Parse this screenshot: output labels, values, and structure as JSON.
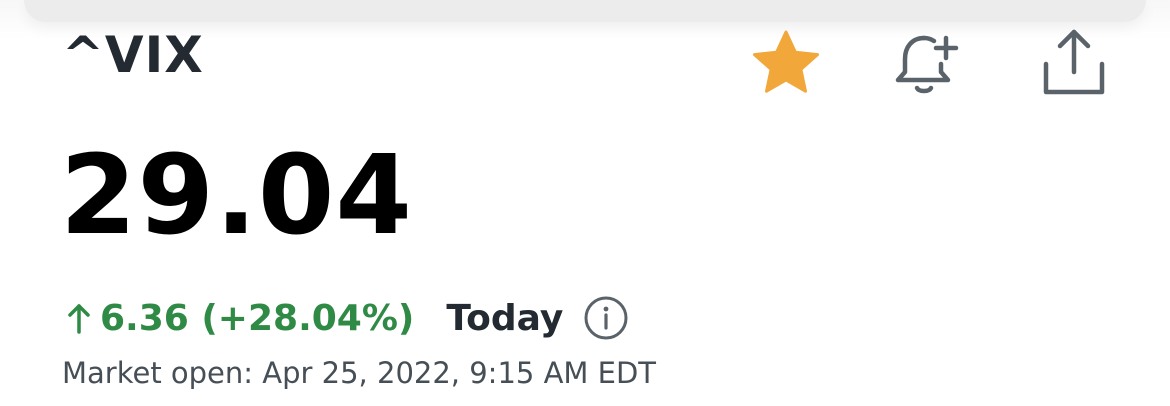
{
  "header": {
    "ticker": "^VIX",
    "icons": {
      "watchlist": "star-icon",
      "alert": "add-alert-bell-icon",
      "share": "share-icon"
    }
  },
  "quote": {
    "price": "29.04",
    "change": "6.36 (+28.04%)",
    "direction_icon": "arrow-up-icon",
    "period": "Today",
    "info_icon": "info-icon",
    "market_status": "Market open: Apr 25, 2022, 9:15 AM EDT"
  },
  "colors": {
    "star": "#f2a73b",
    "positive": "#2f8a45",
    "icon_gray": "#5b636a",
    "text_dark": "#232a31",
    "text_muted": "#464e56"
  }
}
